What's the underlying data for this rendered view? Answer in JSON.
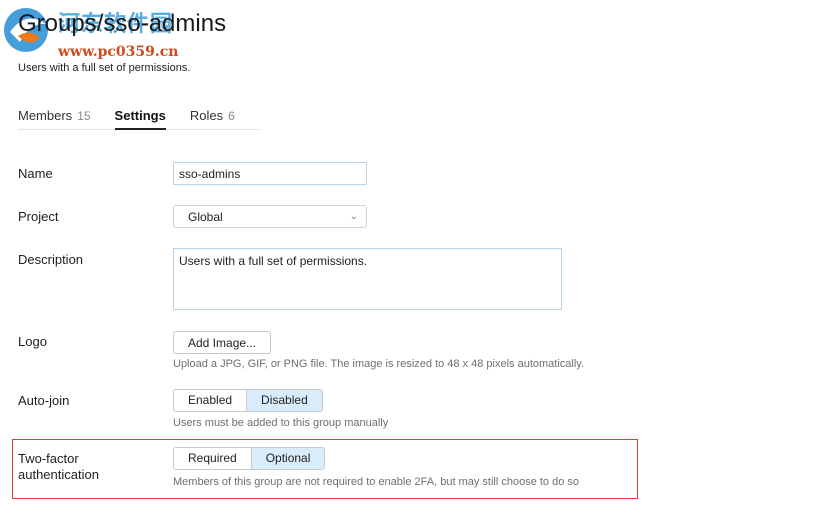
{
  "watermark": {
    "site_name": "河东软件园",
    "url": "www.pc0359.cn"
  },
  "header": {
    "title": "Groups/sso-admins",
    "subtitle": "Users with a full set of permissions."
  },
  "tabs": [
    {
      "label": "Members",
      "count": "15"
    },
    {
      "label": "Settings",
      "count": ""
    },
    {
      "label": "Roles",
      "count": "6"
    }
  ],
  "form": {
    "name": {
      "label": "Name",
      "value": "sso-admins"
    },
    "project": {
      "label": "Project",
      "value": "Global"
    },
    "description": {
      "label": "Description",
      "value": "Users with a full set of permissions."
    },
    "logo": {
      "label": "Logo",
      "button": "Add Image...",
      "help": "Upload a JPG, GIF, or PNG file. The image is resized to 48 x 48 pixels automatically."
    },
    "auto_join": {
      "label": "Auto-join",
      "options": [
        "Enabled",
        "Disabled"
      ],
      "selected": "Disabled",
      "help": "Users must be added to this group manually"
    },
    "two_factor": {
      "label_line1": "Two-factor",
      "label_line2": "authentication",
      "options": [
        "Required",
        "Optional"
      ],
      "selected": "Optional",
      "help": "Members of this group are not required to enable 2FA, but may still choose to do so"
    }
  },
  "colors": {
    "accent_selected": "#d9ecfb",
    "highlight_border": "#e0383a"
  }
}
